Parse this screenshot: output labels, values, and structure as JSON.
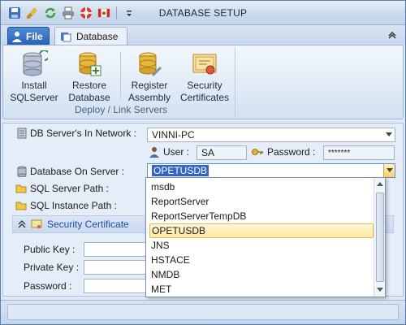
{
  "window": {
    "title": "DATABASE SETUP"
  },
  "quick_access": [
    "save-icon",
    "brush-icon",
    "refresh-icon",
    "print-icon",
    "help-icon",
    "canada-flag-icon",
    "customize-dropdown-icon"
  ],
  "tabs": {
    "file": "File",
    "database": "Database"
  },
  "ribbon": {
    "group_label": "Deploy / Link Servers",
    "buttons": [
      {
        "label": "Install\nSQLServer",
        "icon": "server-install-icon"
      },
      {
        "label": "Restore\nDatabase",
        "icon": "database-restore-icon"
      },
      {
        "label": "Register\nAssembly",
        "icon": "database-register-icon"
      },
      {
        "label": "Security\nCertificates",
        "icon": "certificate-icon"
      }
    ]
  },
  "form": {
    "db_server_label": "DB Server's In Network :",
    "db_server_value": "VINNI-PC",
    "user_label": "User :",
    "user_value": "SA",
    "password_label": "Password :",
    "password_value": "*******",
    "database_label": "Database On Server :",
    "database_value": "OPETUSDB",
    "sql_path_label": "SQL Server Path :",
    "sql_instance_label": "SQL Instance Path :",
    "security_cert_header": "Security Certificate",
    "public_key_label": "Public Key :",
    "private_key_label": "Private Key :",
    "password2_label": "Password :"
  },
  "dropdown": {
    "items": [
      "msdb",
      "ReportServer",
      "ReportServerTempDB",
      "OPETUSDB",
      "JNS",
      "HSTACE",
      "NMDB",
      "MET"
    ],
    "selected": "OPETUSDB"
  },
  "colors": {
    "accent": "#2a62b6",
    "selection": "#fde9a3",
    "highlight_text": "#3166c4"
  }
}
